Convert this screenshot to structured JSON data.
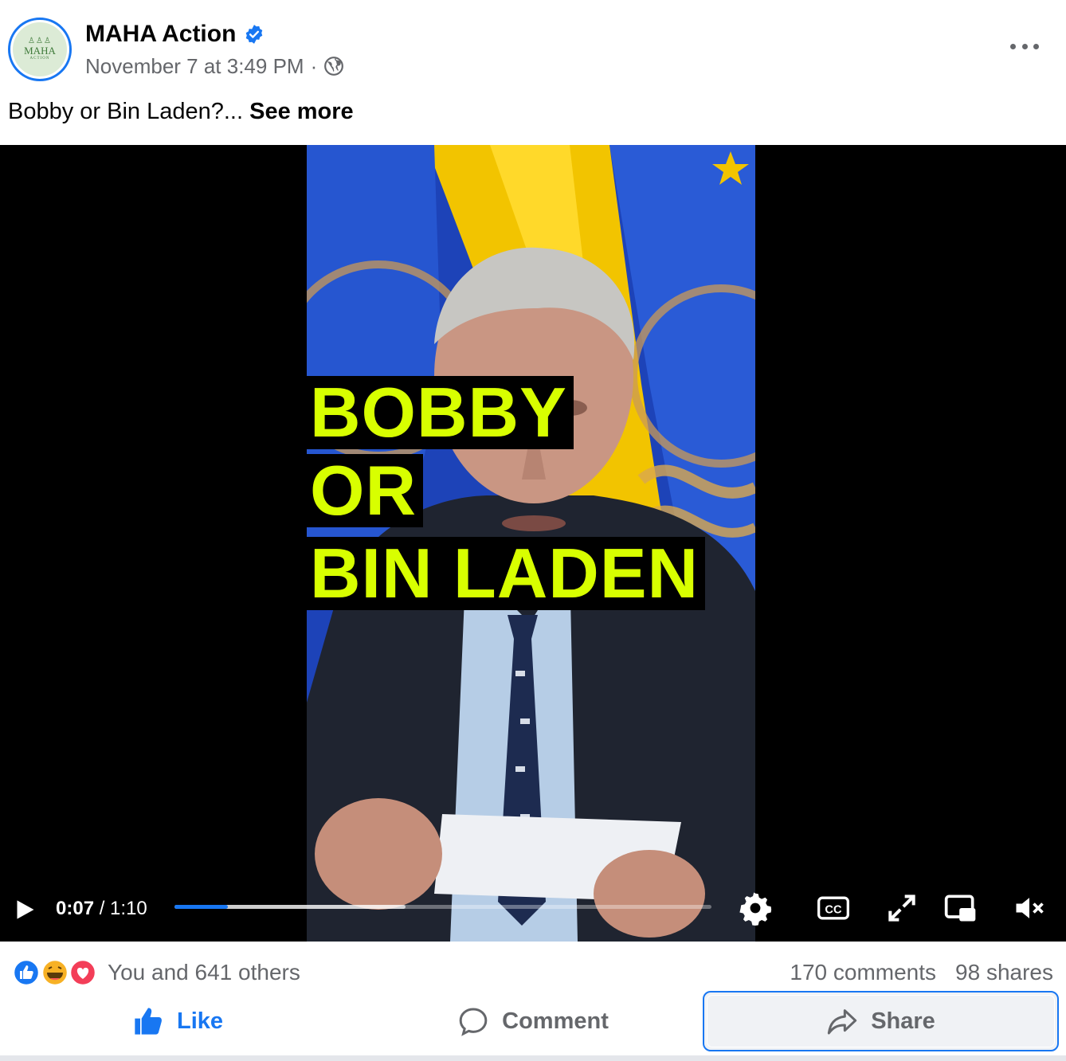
{
  "post": {
    "page_name": "MAHA Action",
    "avatar_text": "MAHA",
    "avatar_subtext": "ACTION",
    "timestamp": "November 7 at 3:49 PM",
    "separator": "·",
    "caption": "Bobby or Bin Laden?...",
    "see_more": "See more"
  },
  "video": {
    "overlay_lines": [
      "BOBBY",
      "OR",
      "BIN LADEN"
    ],
    "current_time": "0:07",
    "duration": "/ 1:10",
    "played_fraction": 0.1,
    "buffered_fraction": 0.43,
    "controls": [
      "play-icon",
      "settings-icon",
      "closed-captions-icon",
      "fullscreen-icon",
      "picture-in-picture-icon",
      "muted-icon"
    ]
  },
  "engagement": {
    "reactions": [
      "like-reaction-icon",
      "haha-reaction-icon",
      "love-reaction-icon"
    ],
    "reaction_text": "You and 641 others",
    "comments": "170 comments",
    "shares": "98 shares"
  },
  "actions": {
    "like_label": "Like",
    "comment_label": "Comment",
    "share_label": "Share"
  },
  "colors": {
    "facebook_blue": "#1877f2",
    "overlay_yellow": "#d8ff00",
    "secondary_text": "#65676b"
  }
}
